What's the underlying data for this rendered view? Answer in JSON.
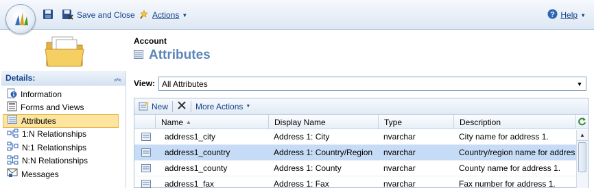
{
  "toolbar": {
    "save_and_close": "Save and Close",
    "actions": "Actions",
    "help": "Help"
  },
  "header": {
    "entity": "Account",
    "title": "Attributes"
  },
  "nav": {
    "title": "Details:",
    "items": [
      {
        "label": "Information",
        "icon": "info-icon"
      },
      {
        "label": "Forms and Views",
        "icon": "form-icon"
      },
      {
        "label": "Attributes",
        "icon": "attributes-icon",
        "selected": true
      },
      {
        "label": "1:N Relationships",
        "icon": "relationship-icon"
      },
      {
        "label": "N:1 Relationships",
        "icon": "relationship-icon"
      },
      {
        "label": "N:N Relationships",
        "icon": "relationship-icon"
      },
      {
        "label": "Messages",
        "icon": "messages-icon"
      }
    ]
  },
  "view": {
    "label": "View:",
    "selected": "All Attributes"
  },
  "grid": {
    "toolbar": {
      "new": "New",
      "more_actions": "More Actions"
    },
    "columns": [
      "Name",
      "Display Name",
      "Type",
      "Description"
    ],
    "rows": [
      {
        "name": "address1_city",
        "display": "Address 1: City",
        "type": "nvarchar",
        "desc": "City name for address 1."
      },
      {
        "name": "address1_country",
        "display": "Address 1: Country/Region",
        "type": "nvarchar",
        "desc": "Country/region name for address",
        "selected": true
      },
      {
        "name": "address1_county",
        "display": "Address 1: County",
        "type": "nvarchar",
        "desc": "County name for address 1."
      },
      {
        "name": "address1_fax",
        "display": "Address 1: Fax",
        "type": "nvarchar",
        "desc": "Fax number for address 1."
      }
    ]
  },
  "colors": {
    "link": "#15428b",
    "title": "#5b86b8",
    "selected_nav": "#fde59f",
    "selected_row": "#c6dbf5"
  }
}
